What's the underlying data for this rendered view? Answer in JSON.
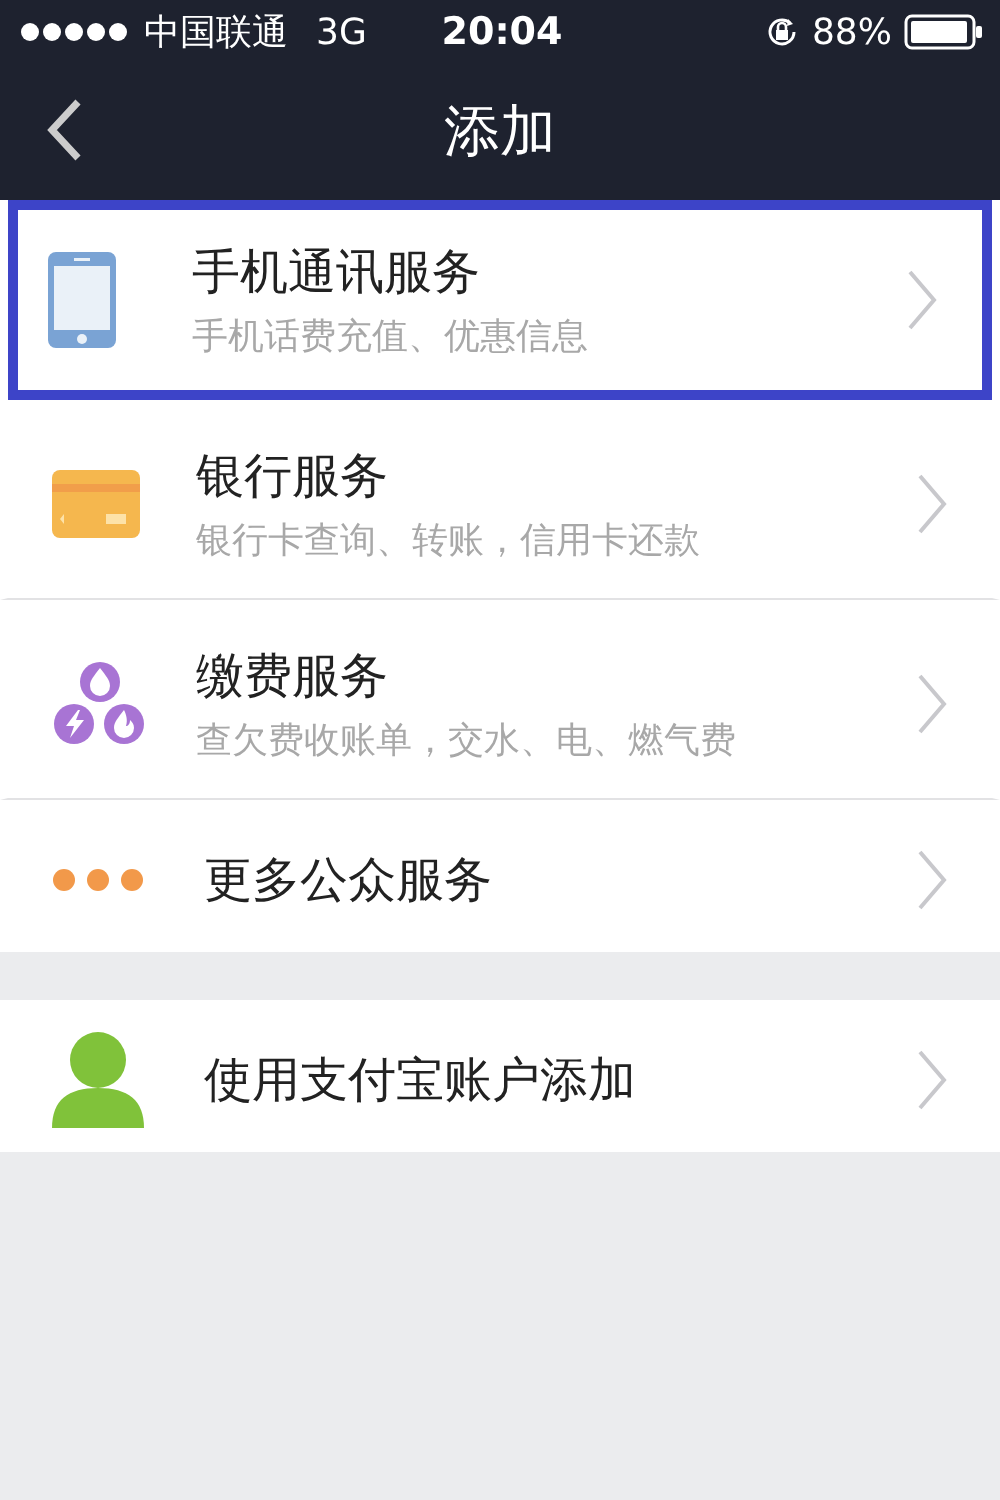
{
  "status_bar": {
    "carrier": "中国联通",
    "network": "3G",
    "time": "20:04",
    "battery": "88%"
  },
  "nav": {
    "title": "添加"
  },
  "groups": [
    {
      "items": [
        {
          "kind": "phone",
          "title": "手机通讯服务",
          "subtitle": "手机话费充值、优惠信息",
          "highlighted": true
        },
        {
          "kind": "card",
          "title": "银行服务",
          "subtitle": "银行卡查询、转账，信用卡还款",
          "highlighted": false
        },
        {
          "kind": "bills",
          "title": "缴费服务",
          "subtitle": "查欠费收账单，交水、电、燃气费",
          "highlighted": false
        },
        {
          "kind": "more",
          "title": "更多公众服务",
          "highlighted": false
        }
      ]
    },
    {
      "items": [
        {
          "kind": "person",
          "title": "使用支付宝账户添加",
          "highlighted": false
        }
      ]
    }
  ]
}
